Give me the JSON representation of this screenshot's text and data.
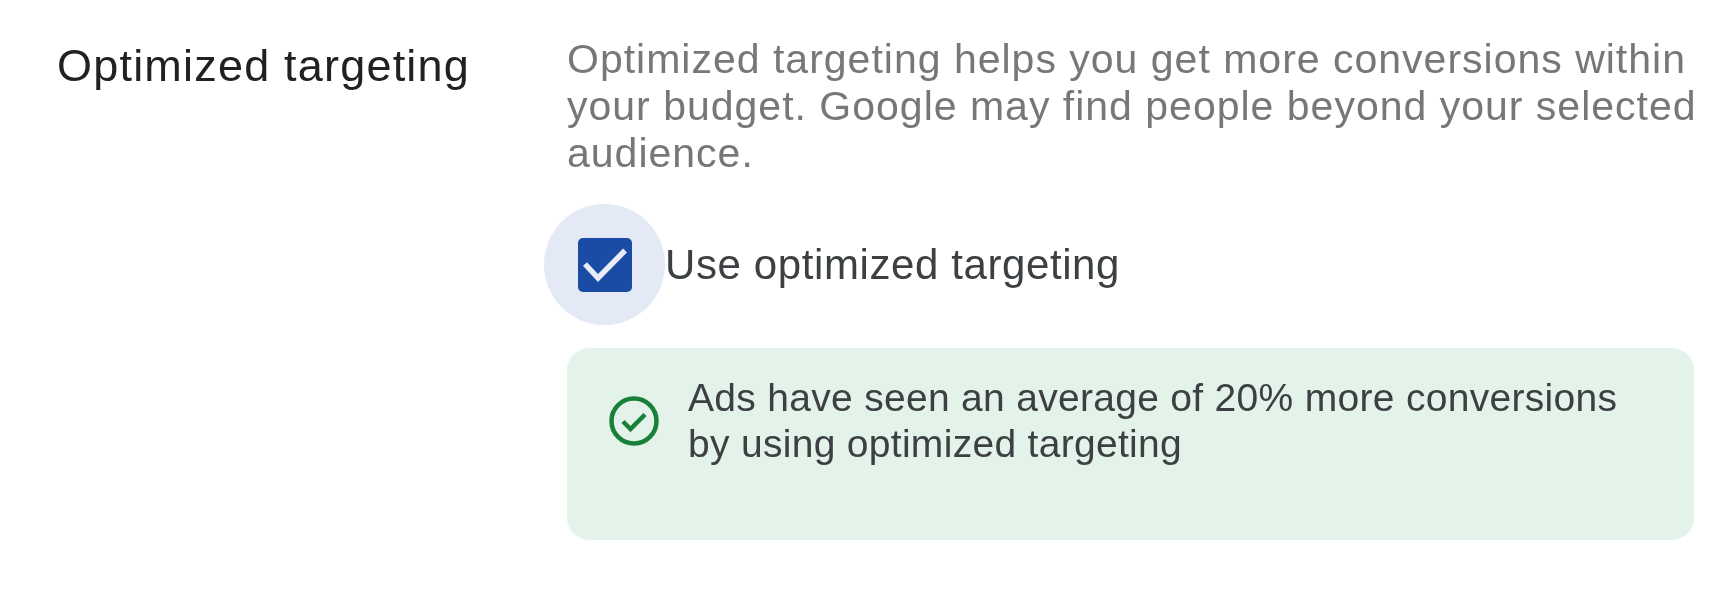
{
  "setting": {
    "title": "Optimized targeting",
    "description": "Optimized targeting helps you get more conversions within your budget. Google may find people beyond your selected audience.",
    "option": {
      "label": "Use optimized targeting",
      "checked": true,
      "focused": true
    },
    "notice": {
      "text": "Ads have seen an average of 20% more conversions by using optimized targeting"
    }
  }
}
